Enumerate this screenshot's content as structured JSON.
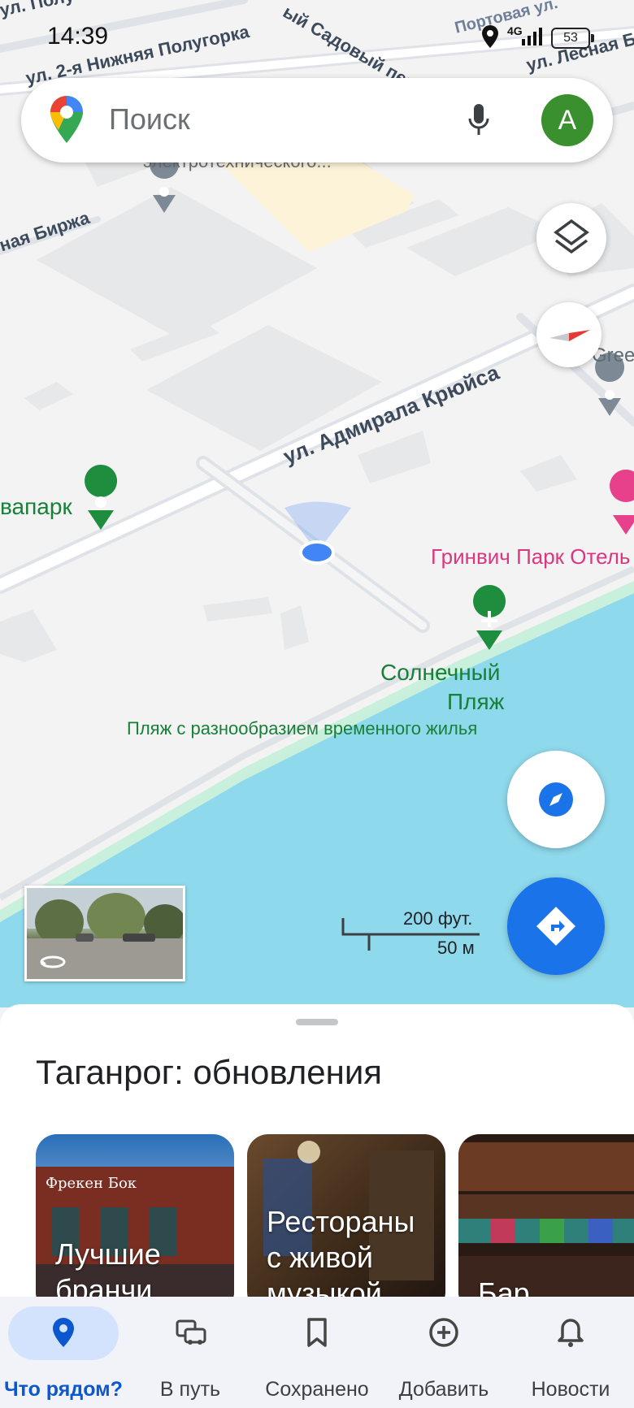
{
  "status_bar": {
    "time": "14:39",
    "network": "4G",
    "battery": "53"
  },
  "search": {
    "placeholder": "Поиск",
    "avatar_letter": "A"
  },
  "map": {
    "streets": [
      "ул. Полугорка",
      "ул. 2-я Нижняя Полугорка",
      "ый Садовый пер.",
      "Портовая ул.",
      "ул. Лесная Б",
      "электротехнического...",
      "ная Биржа",
      "ул. Адмирала Крюйса",
      "Gree"
    ],
    "places": [
      {
        "name": "вапарк",
        "color": "#188038"
      },
      {
        "name": "Гринвич Парк Отель",
        "color": "#d93880"
      },
      {
        "name_line1": "Солнечный",
        "name_line2": "Пляж",
        "subtitle": "Пляж с разнообразием временного жилья",
        "color": "#188038"
      }
    ],
    "scale": {
      "imperial": "200 фут.",
      "metric": "50 м"
    },
    "colors": {
      "water": "#8fd9ec",
      "my_location": "#4285f4",
      "accent": "#1a73e8"
    }
  },
  "sheet": {
    "title": "Таганрог: обновления",
    "cards": [
      {
        "label_lines": [
          "Лучшие",
          "бранчи"
        ],
        "sign": "Фрекен Бок"
      },
      {
        "label_lines": [
          "Рестораны",
          "с живой",
          "музыкой"
        ]
      },
      {
        "label_lines": [
          "",
          "",
          "Бар"
        ]
      }
    ]
  },
  "nav": {
    "items": [
      {
        "label": "Что рядом?",
        "icon": "place-pin-icon",
        "active": true
      },
      {
        "label": "В путь",
        "icon": "commute-icon"
      },
      {
        "label": "Сохранено",
        "icon": "bookmark-icon"
      },
      {
        "label": "Добавить",
        "icon": "add-circle-icon"
      },
      {
        "label": "Новости",
        "icon": "bell-icon"
      }
    ]
  }
}
